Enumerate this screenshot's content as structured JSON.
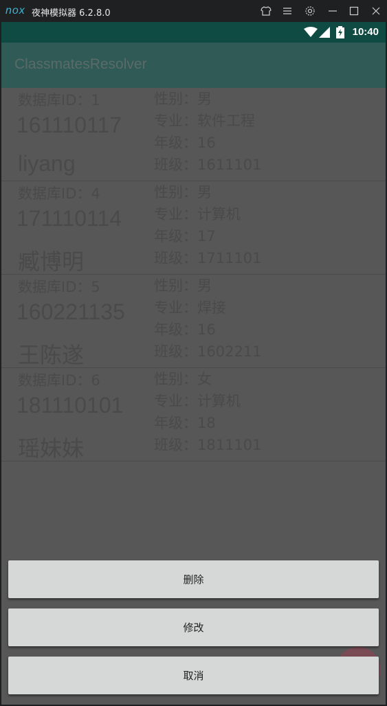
{
  "emulator": {
    "logo": "nox",
    "title": "夜神模拟器 6.2.8.0",
    "controls": [
      "shirt-icon",
      "menu-icon",
      "gear-icon",
      "minimize-icon",
      "maximize-icon",
      "close-icon"
    ]
  },
  "statusbar": {
    "time": "10:40"
  },
  "appbar": {
    "title": "ClassmatesResolver"
  },
  "students": [
    {
      "id_label": "数据库ID：1",
      "number": "161110117",
      "name": "liyang",
      "gender": "性别：男",
      "major": "专业：软件工程",
      "grade": "年级：16",
      "class": "班级：1611101"
    },
    {
      "id_label": "数据库ID：4",
      "number": "171110114",
      "name": "臧博明",
      "gender": "性别：男",
      "major": "专业：计算机",
      "grade": "年级：17",
      "class": "班级：1711101"
    },
    {
      "id_label": "数据库ID：5",
      "number": "160221135",
      "name": "王陈遂",
      "gender": "性别：男",
      "major": "专业：焊接",
      "grade": "年级：16",
      "class": "班级：1602211"
    },
    {
      "id_label": "数据库ID：6",
      "number": "181110101",
      "name": "瑶妹妹",
      "gender": "性别：女",
      "major": "专业：计算机",
      "grade": "年级：18",
      "class": "班级：1811101"
    }
  ],
  "actions": {
    "delete": "删除",
    "edit": "修改",
    "cancel": "取消"
  },
  "colors": {
    "statusbar": "#0f4a43",
    "appbar": "#2f5a55",
    "overlay": "#575757",
    "button": "#d6d7d7"
  }
}
